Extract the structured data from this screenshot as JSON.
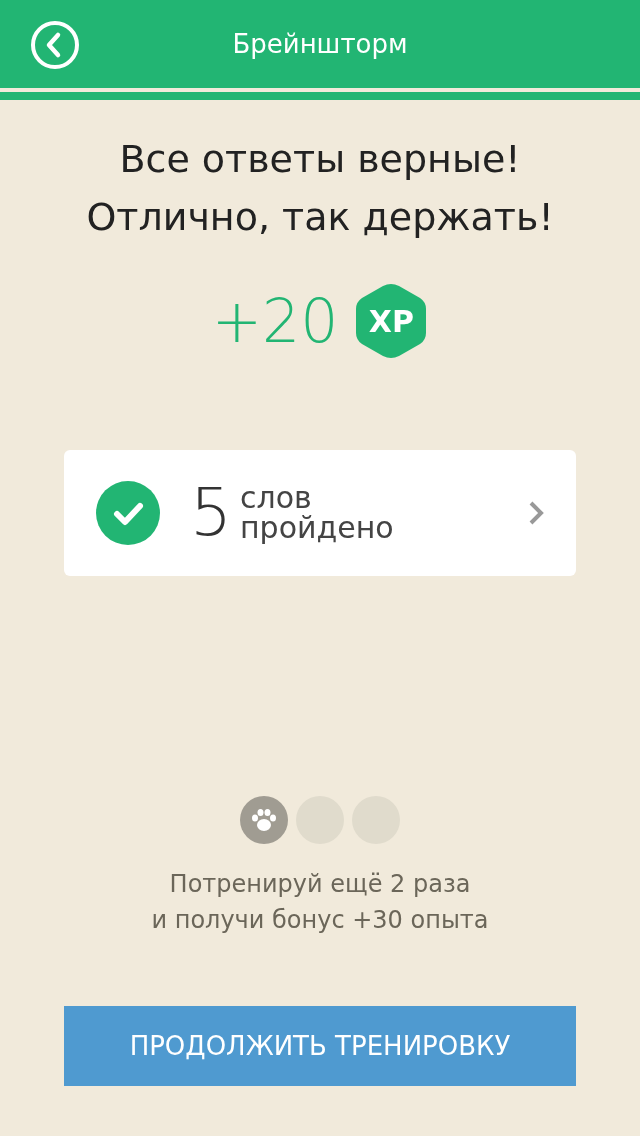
{
  "header": {
    "title": "Брейншторм"
  },
  "result": {
    "lines": [
      "Все ответы верные!",
      "Отлично, так держать!"
    ],
    "xp_amount": "+20",
    "xp_badge": "XP"
  },
  "summary": {
    "checked": true,
    "count": "5",
    "label_top": "слов",
    "label_bottom": "пройдено"
  },
  "progress": [
    {
      "completed": true
    },
    {
      "completed": false
    },
    {
      "completed": false
    }
  ],
  "hint": "Потренируй ещё 2 раза\nи получи бонус +30 опыта",
  "button": {
    "label": "ПРОДОЛЖИТЬ ТРЕНИРОВКУ"
  }
}
